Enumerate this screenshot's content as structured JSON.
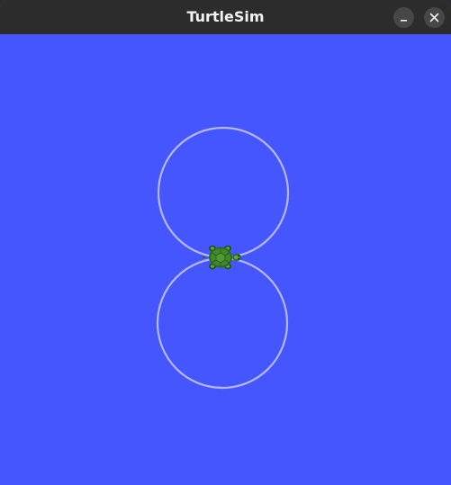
{
  "window": {
    "title": "TurtleSim",
    "controls": [
      {
        "name": "minimize",
        "icon": "minimize-icon"
      },
      {
        "name": "close",
        "icon": "close-icon"
      }
    ]
  },
  "canvas": {
    "background_color": "#4556ff",
    "pen_color": "#b3b8ff",
    "path_shape": "figure-eight",
    "turtle": {
      "icon": "turtle-icon",
      "color": "#3f8a2a",
      "heading": "right"
    }
  }
}
